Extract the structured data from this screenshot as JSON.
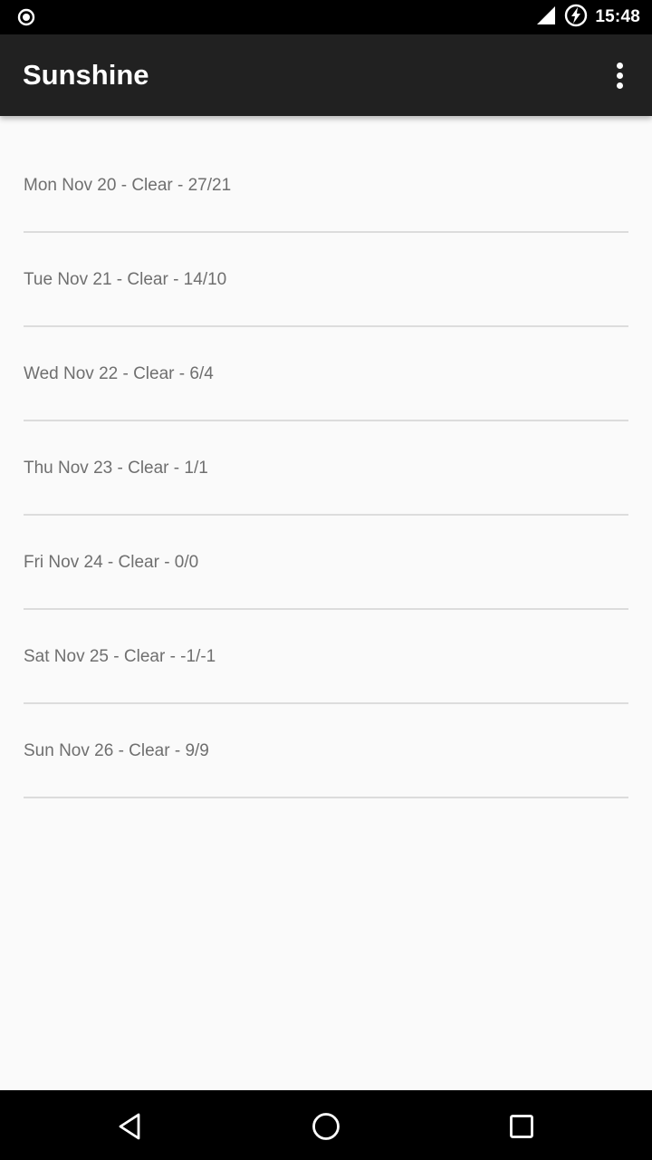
{
  "status_bar": {
    "time": "15:48",
    "icons": [
      "radio-button-icon",
      "signal-icon",
      "battery-charging-icon"
    ]
  },
  "app_bar": {
    "title": "Sunshine",
    "menu_icon": "more-vert-icon"
  },
  "forecast": [
    "Mon Nov 20 - Clear - 27/21",
    "Tue Nov 21 - Clear - 14/10",
    "Wed Nov 22 - Clear - 6/4",
    "Thu Nov 23 - Clear - 1/1",
    "Fri Nov 24 - Clear - 0/0",
    "Sat Nov 25 - Clear - -1/-1",
    "Sun Nov 26 - Clear - 9/9"
  ],
  "nav_bar": {
    "icons": [
      "back-icon",
      "home-icon",
      "recents-icon"
    ]
  },
  "colors": {
    "status_bar": "#000000",
    "app_bar": "#212121",
    "background": "#fafafa",
    "divider": "#dcdcdc",
    "item_text": "#6f6f6f"
  }
}
